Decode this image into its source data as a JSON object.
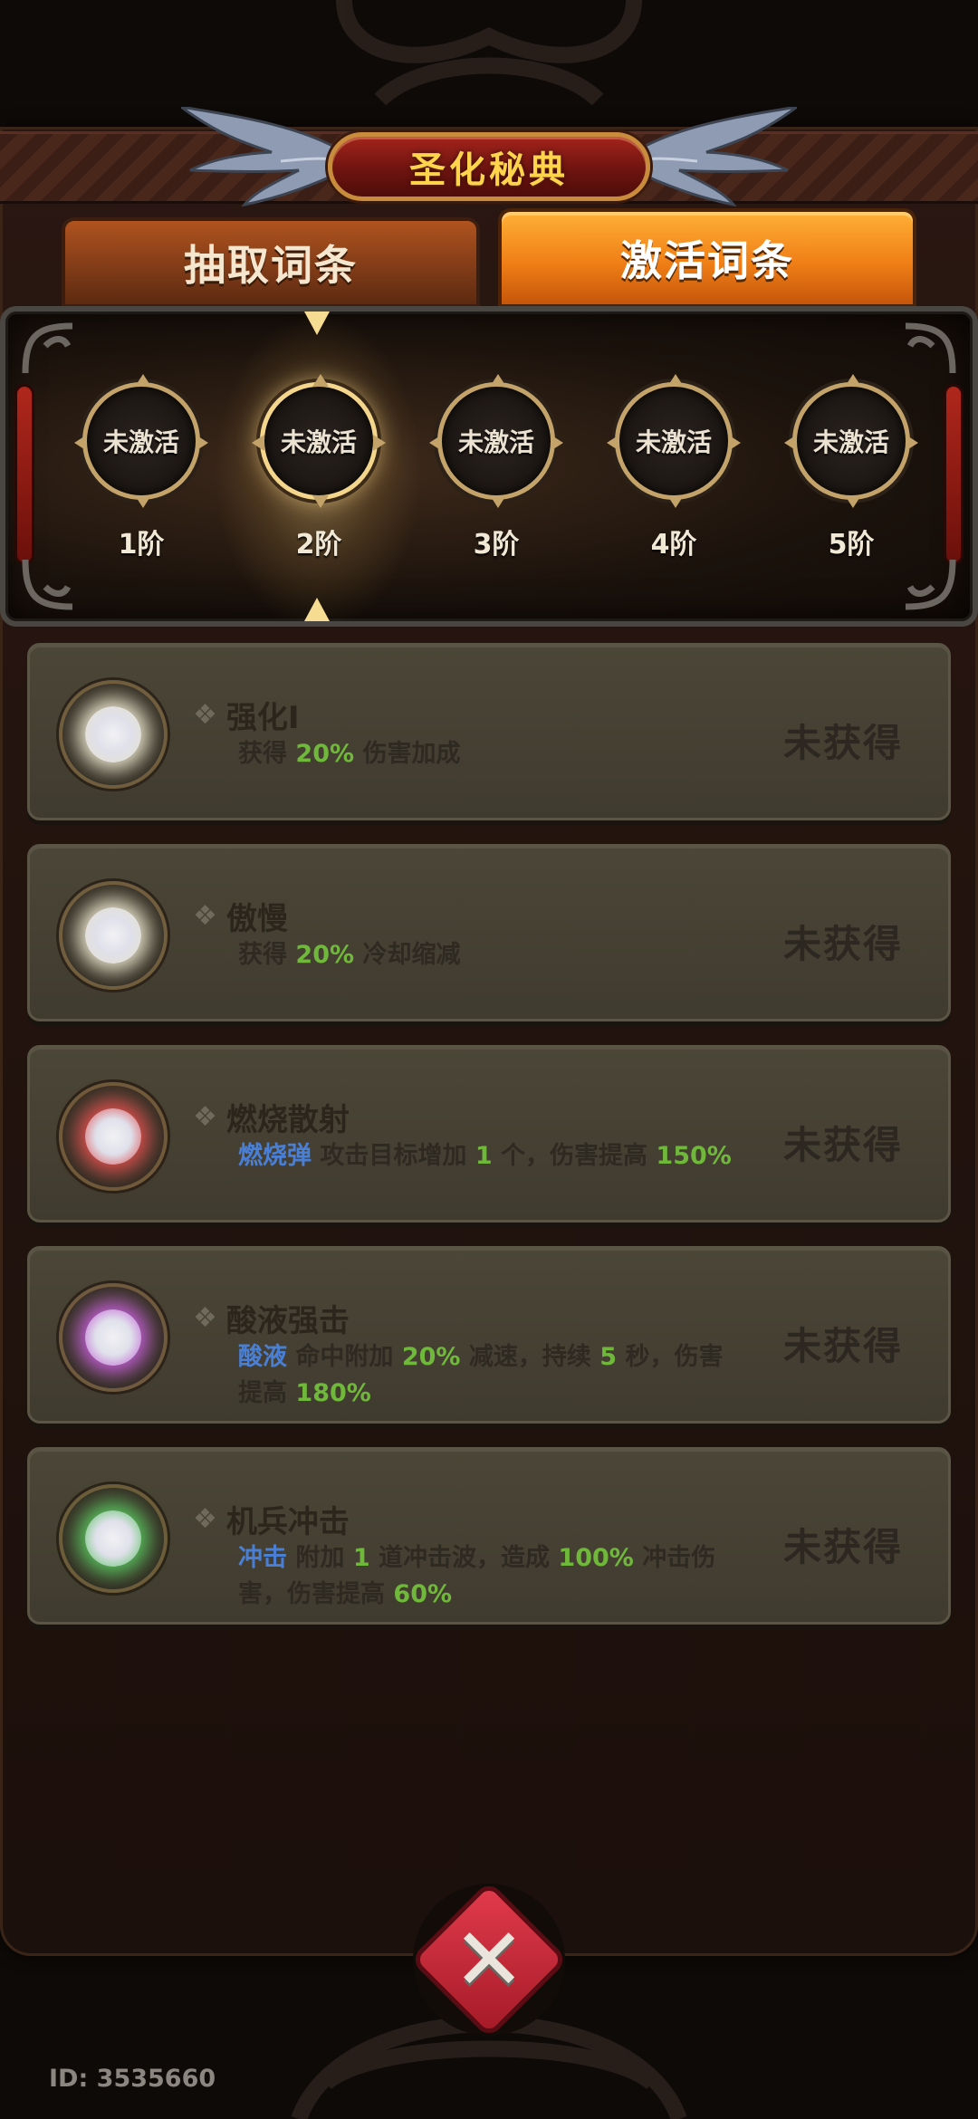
{
  "header": {
    "title": "圣化秘典"
  },
  "tabs": [
    {
      "label": "抽取词条",
      "active": false
    },
    {
      "label": "激活词条",
      "active": true
    }
  ],
  "tiers": [
    {
      "status": "未激活",
      "label": "1阶"
    },
    {
      "status": "未激活",
      "label": "2阶"
    },
    {
      "status": "未激活",
      "label": "3阶"
    },
    {
      "status": "未激活",
      "label": "4阶"
    },
    {
      "status": "未激活",
      "label": "5阶"
    }
  ],
  "affixes": [
    {
      "title": "强化I",
      "orb_color": "#e8e2cc",
      "desc": {
        "p1": "获得 ",
        "g1": "20%",
        "p2": " 伤害加成"
      },
      "status": "未获得"
    },
    {
      "title": "傲慢",
      "orb_color": "#e8e2cc",
      "desc": {
        "p1": "获得 ",
        "g1": "20%",
        "p2": " 冷却缩减"
      },
      "status": "未获得"
    },
    {
      "title": "燃烧散射",
      "orb_color": "#e04a4a",
      "desc": {
        "b1": "燃烧弹",
        "p1": " 攻击目标增加 ",
        "g1": "1",
        "p2": " 个，伤害提高 ",
        "g2": "150%"
      },
      "status": "未获得"
    },
    {
      "title": "酸液强击",
      "orb_color": "#c25ad6",
      "desc": {
        "b1": "酸液",
        "p1": " 命中附加 ",
        "g1": "20%",
        "p2": " 减速，持续 ",
        "g2": "5",
        "p3": " 秒，伤害提高 ",
        "g3": "180%"
      },
      "status": "未获得"
    },
    {
      "title": "机兵冲击",
      "orb_color": "#54c25a",
      "desc": {
        "b1": "冲击",
        "p1": " 附加 ",
        "g1": "1",
        "p2": " 道冲击波，造成 ",
        "g2": "100%",
        "p3": " 冲击伤害，伤害提高 ",
        "g3": "60%"
      },
      "status": "未获得"
    }
  ],
  "close_button": {
    "icon": "close-x-icon",
    "glyph": "✕"
  },
  "footer": {
    "player_id": "ID: 3535660"
  }
}
